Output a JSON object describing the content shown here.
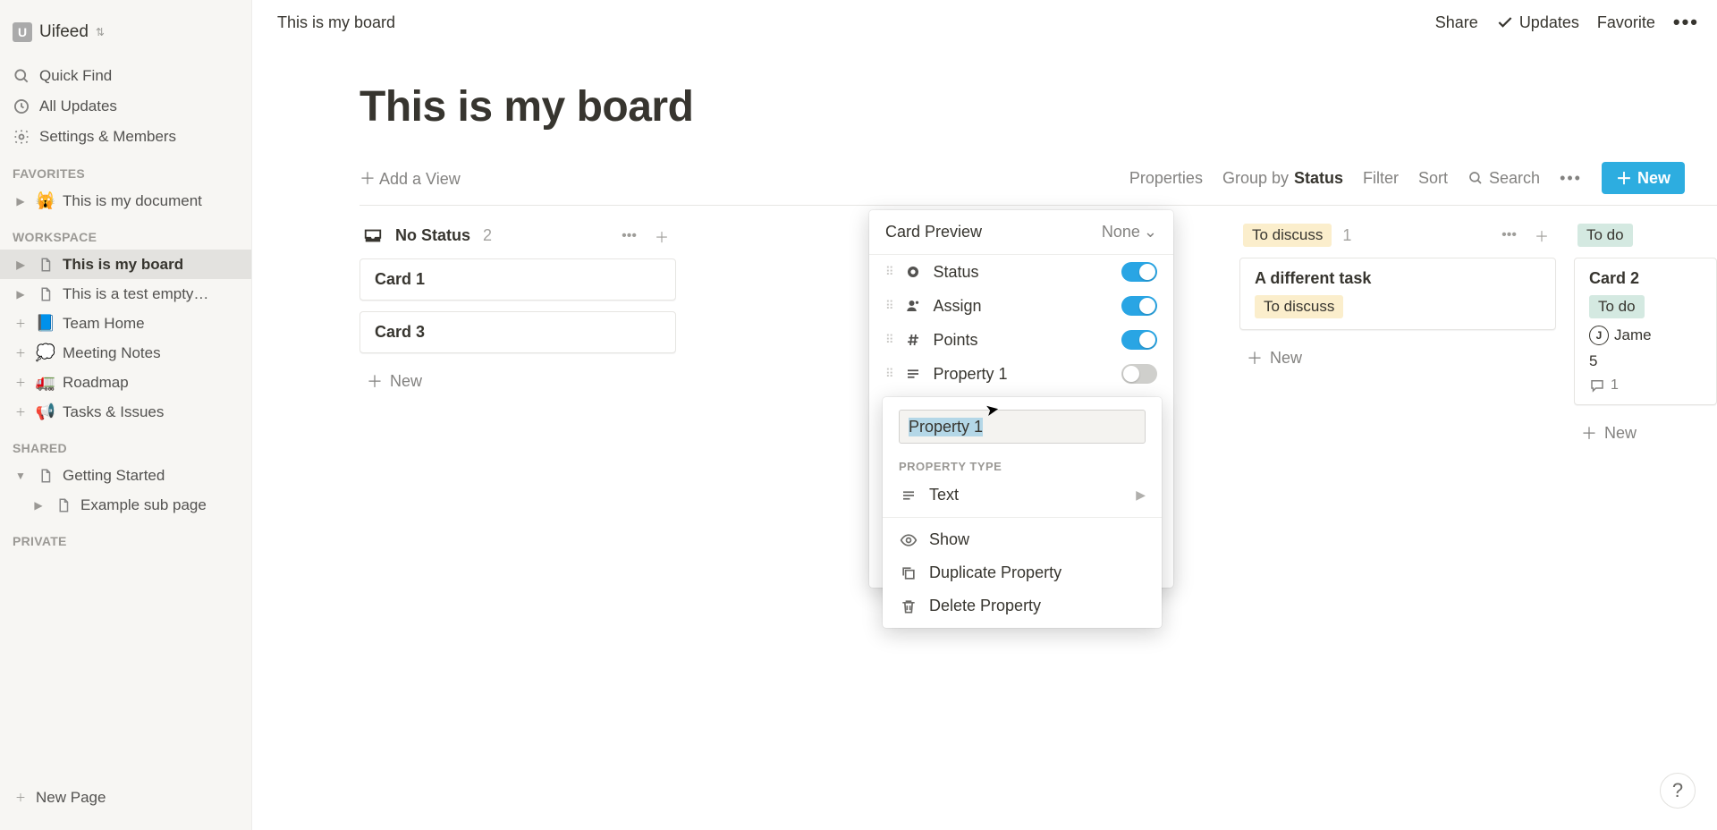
{
  "workspace": {
    "initial": "U",
    "name": "Uifeed"
  },
  "sidebar_top": [
    {
      "icon": "search",
      "label": "Quick Find"
    },
    {
      "icon": "clock",
      "label": "All Updates"
    },
    {
      "icon": "gear",
      "label": "Settings & Members"
    }
  ],
  "sections": {
    "favorites_title": "FAVORITES",
    "favorites": [
      {
        "emoji": "🙀",
        "label": "This is my document"
      }
    ],
    "workspace_title": "WORKSPACE",
    "workspace": [
      {
        "emoji": "page",
        "label": "This is my board",
        "active": true
      },
      {
        "emoji": "page",
        "label": "This is a test empty…"
      },
      {
        "emoji": "📘",
        "label": "Team Home",
        "add": true
      },
      {
        "emoji": "💭",
        "label": "Meeting Notes",
        "add": true
      },
      {
        "emoji": "🚛",
        "label": "Roadmap",
        "add": true
      },
      {
        "emoji": "📢",
        "label": "Tasks & Issues",
        "add": true
      }
    ],
    "shared_title": "SHARED",
    "shared": [
      {
        "emoji": "page",
        "label": "Getting Started",
        "expanded": true
      },
      {
        "emoji": "page",
        "label": "Example sub page",
        "sub": true
      }
    ],
    "private_title": "PRIVATE",
    "new_page": "New Page"
  },
  "topbar": {
    "breadcrumb": "This is my board",
    "share": "Share",
    "updates": "Updates",
    "favorite": "Favorite"
  },
  "page": {
    "title": "This is my board",
    "add_view": "＋ Add a View",
    "controls": {
      "properties": "Properties",
      "group_by_prefix": "Group by ",
      "group_by_value": "Status",
      "filter": "Filter",
      "sort": "Sort",
      "search": "Search",
      "new": "New"
    }
  },
  "board": {
    "columns": [
      {
        "id": "nostatus",
        "icon": "inbox",
        "label": "No Status",
        "count": "2",
        "cards": [
          {
            "title": "Card 1"
          },
          {
            "title": "Card 3"
          }
        ],
        "new": "New"
      },
      {
        "id": "discuss",
        "tag_style": "discuss",
        "label": "To discuss",
        "count": "1",
        "cards": [
          {
            "title": "A different task",
            "tag": "To discuss",
            "tag_style": "discuss"
          }
        ],
        "new": "New"
      },
      {
        "id": "todo",
        "tag_style": "todo",
        "label": "To do",
        "count": "",
        "cards": [
          {
            "title": "Card 2",
            "tag": "To do",
            "tag_style": "todo",
            "assignee_initial": "J",
            "assignee_name": "Jame",
            "points": "5",
            "comments": "1"
          }
        ],
        "new": "New"
      }
    ]
  },
  "popup_props": {
    "title": "Card Preview",
    "none": "None",
    "rows": [
      {
        "icon": "status-dot",
        "label": "Status",
        "on": true
      },
      {
        "icon": "person",
        "label": "Assign",
        "on": true
      },
      {
        "icon": "hash",
        "label": "Points",
        "on": true
      },
      {
        "icon": "text",
        "label": "Property 1",
        "on": false
      }
    ]
  },
  "popup_type": {
    "input_value": "Property 1",
    "section": "PROPERTY TYPE",
    "type_row": "Text",
    "actions": [
      {
        "icon": "eye",
        "label": "Show"
      },
      {
        "icon": "duplicate",
        "label": "Duplicate Property"
      },
      {
        "icon": "trash",
        "label": "Delete Property"
      }
    ]
  },
  "help": "?"
}
